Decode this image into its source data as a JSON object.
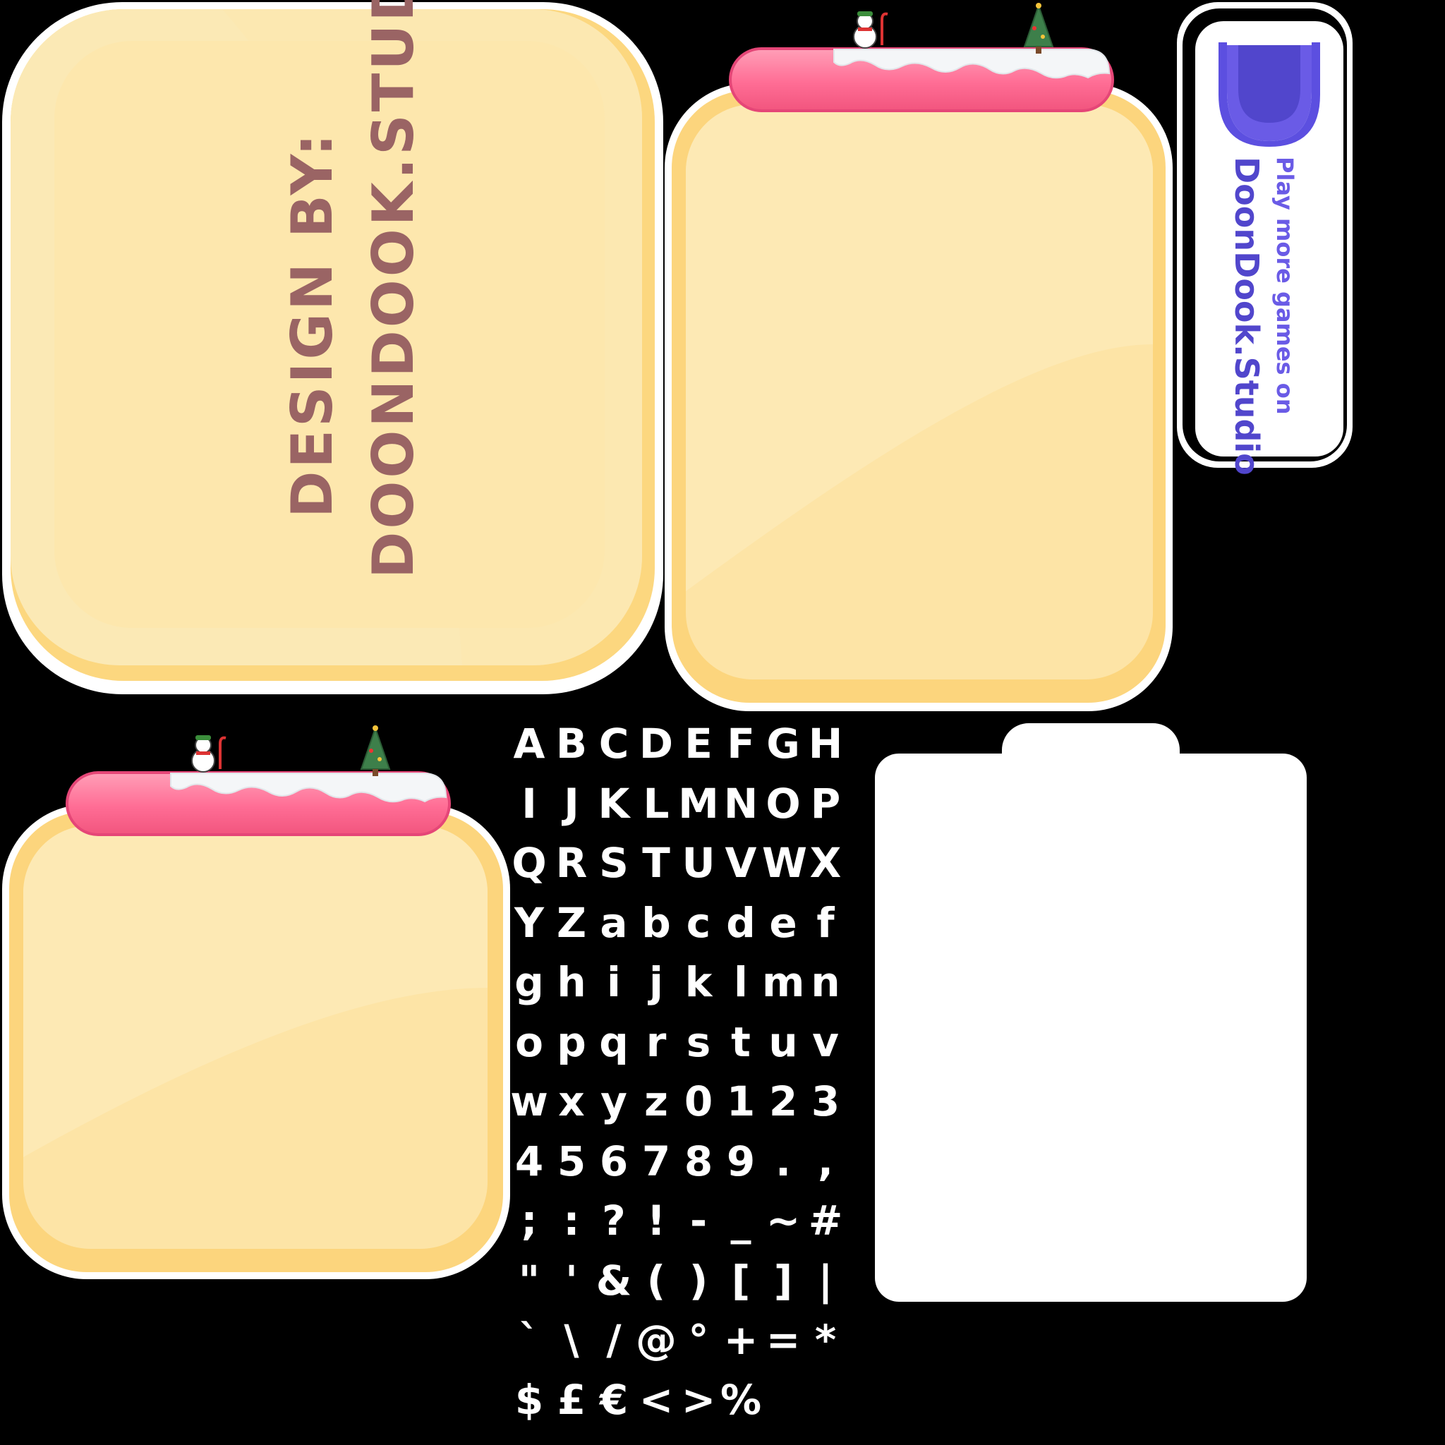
{
  "credit": {
    "line1": "DESIGN BY:",
    "line2": "DOONDOOK.STUDIO"
  },
  "promo": {
    "small_text": "Play more games on",
    "brand_text": "DoonDook.Studio",
    "logo_icon": "doondook-shield-logo-icon"
  },
  "decorations": [
    "snowman-icon",
    "candy-cane-icon",
    "christmas-tree-icon"
  ],
  "colors": {
    "panel_yellow": "#fcd77f",
    "panel_face": "#fde7ad",
    "pink_bar": "#ff6d95",
    "credit_text": "#9a6464",
    "promo_purple": "#5146cc"
  },
  "glyphs": [
    "A",
    "B",
    "C",
    "D",
    "E",
    "F",
    "G",
    "H",
    "I",
    "J",
    "K",
    "L",
    "M",
    "N",
    "O",
    "P",
    "Q",
    "R",
    "S",
    "T",
    "U",
    "V",
    "W",
    "X",
    "Y",
    "Z",
    "a",
    "b",
    "c",
    "d",
    "e",
    "f",
    "g",
    "h",
    "i",
    "j",
    "k",
    "l",
    "m",
    "n",
    "o",
    "p",
    "q",
    "r",
    "s",
    "t",
    "u",
    "v",
    "w",
    "x",
    "y",
    "z",
    "0",
    "1",
    "2",
    "3",
    "4",
    "5",
    "6",
    "7",
    "8",
    "9",
    ".",
    ",",
    ";",
    ":",
    "?",
    "!",
    "-",
    "_",
    "~",
    "#",
    "\"",
    "'",
    "&",
    "(",
    ")",
    "[",
    "]",
    "|",
    "`",
    "\\",
    "/",
    "@",
    "°",
    "+",
    "=",
    "*",
    "$",
    "£",
    "€",
    "<",
    ">",
    "%"
  ]
}
